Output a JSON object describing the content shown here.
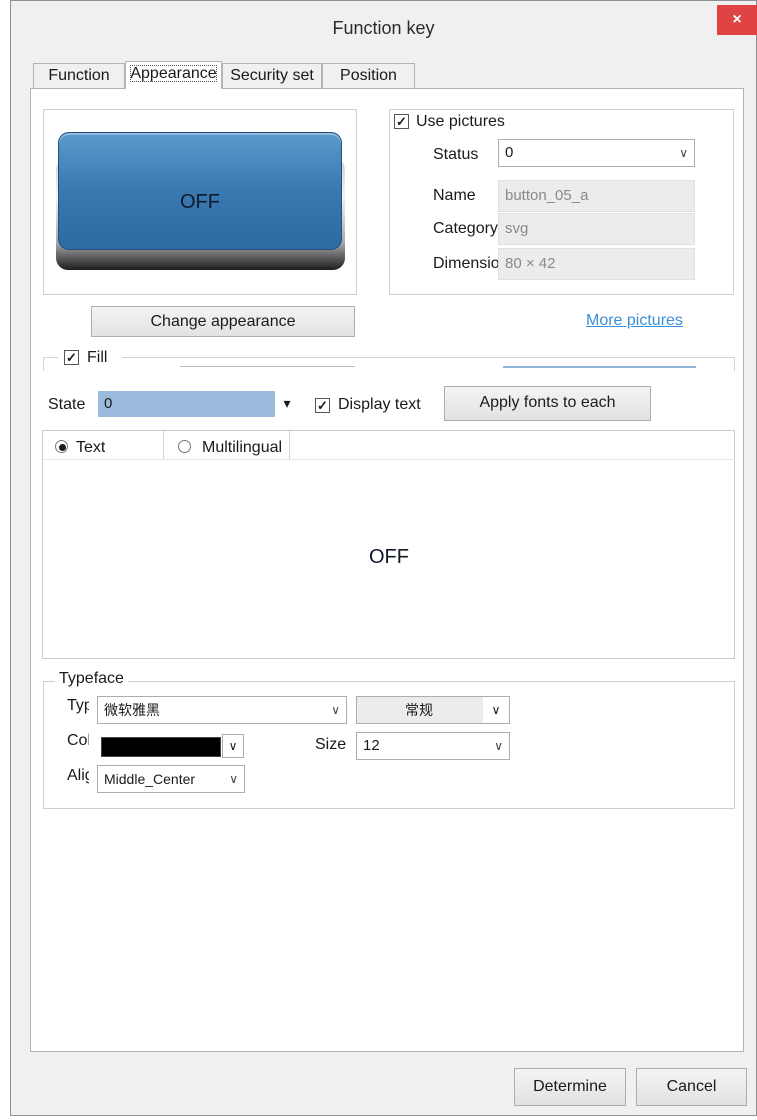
{
  "window": {
    "title": "Function key",
    "close_icon": "×"
  },
  "tabs": [
    {
      "label": "Function",
      "active": false
    },
    {
      "label": "Appearance",
      "active": true
    },
    {
      "label": "Security set",
      "active": false
    },
    {
      "label": "Position",
      "active": false
    }
  ],
  "preview": {
    "button_text": "OFF",
    "button_color": "#3a78b2"
  },
  "pictures": {
    "use_pictures_label": "Use pictures",
    "use_pictures_checked": true,
    "status_label": "Status",
    "status_value": "0",
    "name_label": "Name",
    "name_value": "button_05_a",
    "category_label": "Category",
    "category_value": "svg",
    "dimension_label": "Dimension",
    "dimension_value": "80 × 42"
  },
  "change_appearance_label": "Change appearance",
  "more_pictures_label": "More pictures",
  "fill": {
    "label": "Fill",
    "checked": true
  },
  "state": {
    "label": "State",
    "value": "0"
  },
  "display_text": {
    "label": "Display text",
    "checked": true
  },
  "apply_fonts_label": "Apply fonts to each",
  "text_tabs": {
    "text_label": "Text",
    "multilingual_label": "Multilingual",
    "selected": "text"
  },
  "text_preview": "OFF",
  "typeface": {
    "group_label": "Typeface",
    "type_label": "Type",
    "font_value": "微软雅黑",
    "style_value": "常规",
    "color_label": "Color",
    "color_value": "#000000",
    "size_label": "Size",
    "size_value": "12",
    "align_label": "Alignment",
    "align_value": "Middle_Center"
  },
  "footer": {
    "determine_label": "Determine",
    "cancel_label": "Cancel"
  }
}
